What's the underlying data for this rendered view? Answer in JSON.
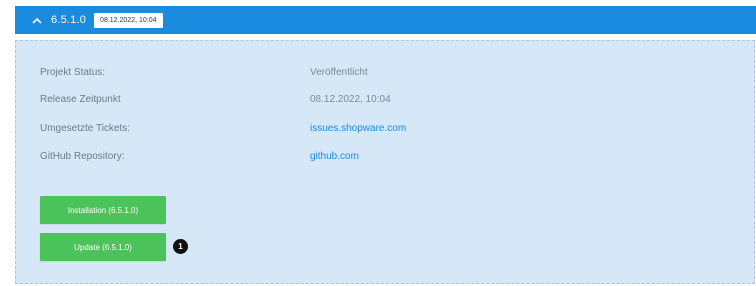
{
  "release": {
    "version": "6.5.1.0",
    "date_badge": "08.12.2022, 10:04"
  },
  "details": [
    {
      "label": "Projekt Status:",
      "value": "Veröffentlicht",
      "is_link": false
    },
    {
      "label": "Release Zeitpunkt",
      "value": "08.12.2022, 10:04",
      "is_link": false
    },
    {
      "label": "Umgesetzte Tickets:",
      "value": "issues.shopware.com",
      "is_link": true
    },
    {
      "label": "GitHub Repository:",
      "value": "github.com",
      "is_link": true
    }
  ],
  "actions": {
    "installation_label": "Installation (6.5.1.0)",
    "update_label": "Update (6.5.1.0)",
    "step_number": "1"
  },
  "icons": {
    "header_toggle": "chevron-up-icon"
  },
  "colors": {
    "header": "#1a8ce0",
    "panel": "#d6e7f7",
    "button": "#4cc25a",
    "link": "#1a8ce0"
  }
}
